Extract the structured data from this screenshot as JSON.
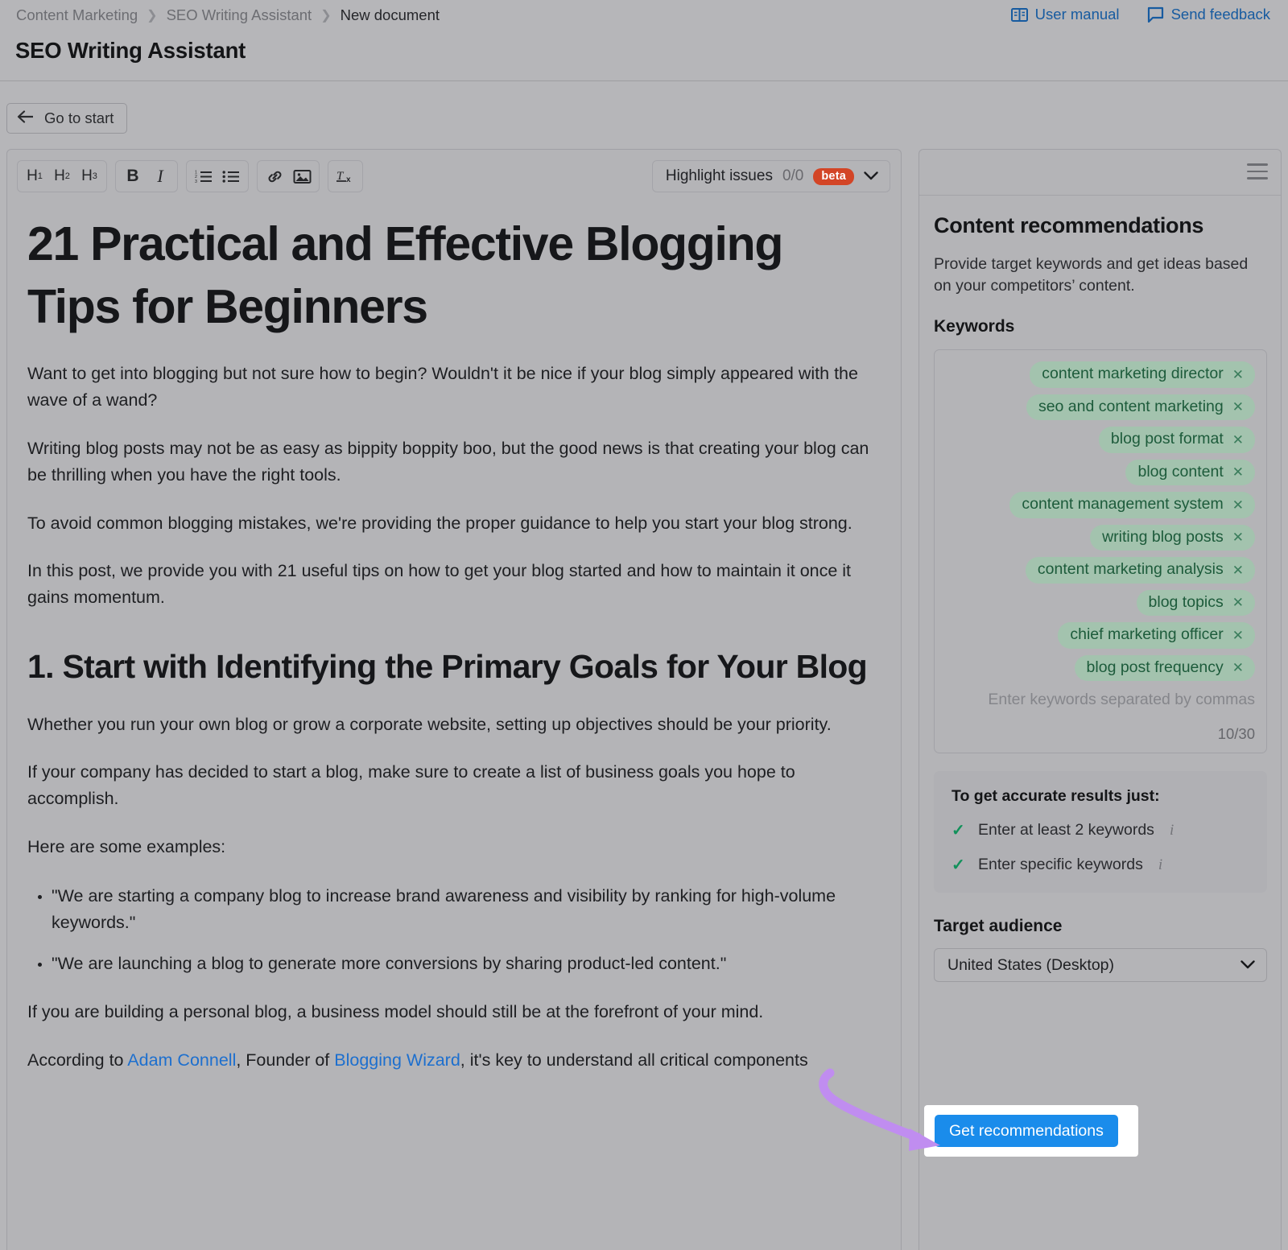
{
  "header": {
    "breadcrumb": [
      "Content Marketing",
      "SEO Writing Assistant",
      "New document"
    ],
    "title": "SEO Writing Assistant",
    "links": [
      {
        "label": "User manual",
        "icon": "book-icon"
      },
      {
        "label": "Send feedback",
        "icon": "speech-bubble-icon"
      }
    ]
  },
  "subbar": {
    "go_to_start": "Go to start"
  },
  "toolbar": {
    "headings": [
      "H1",
      "H2",
      "H3"
    ],
    "bold": "B",
    "italic": "I",
    "ordered_list": "ordered-list-icon",
    "bullet_list": "bullet-list-icon",
    "link": "link-icon",
    "image": "image-icon",
    "clear_format": "Tx",
    "highlight_issues": {
      "label": "Highlight issues",
      "count": "0/0",
      "badge": "beta"
    }
  },
  "document": {
    "h1": "21 Practical and Effective Blogging Tips for Beginners",
    "p1": "Want to get into blogging but not sure how to begin? Wouldn't it be nice if your blog simply appeared with the wave of a wand?",
    "p2": "Writing blog posts may not be as easy as bippity boppity boo, but the good news is that creating your blog can be thrilling when you have the right tools.",
    "p3": "To avoid common blogging mistakes, we're providing the proper guidance to help you start your blog strong.",
    "p4": "In this post, we provide you with 21 useful tips on how to get your blog started and how to maintain it once it gains momentum.",
    "h2": "1. Start with Identifying the Primary Goals for Your Blog",
    "p5": "Whether you run your own blog or grow a corporate website, setting up objectives should be your priority.",
    "p6": "If your company has decided to start a blog, make sure to create a list of business goals you hope to accomplish.",
    "p7": "Here are some examples:",
    "bullets": [
      "\"We are starting a company blog to increase brand awareness and visibility by ranking for high-volume keywords.\"",
      "\"We are launching a blog to generate more conversions by sharing product-led content.\""
    ],
    "p8": "If you are building a personal blog, a business model should still be at the forefront of your mind.",
    "p9_a": "According to ",
    "p9_link1": "Adam Connell",
    "p9_b": ", Founder of ",
    "p9_link2": "Blogging Wizard",
    "p9_c": ", it's key to understand all critical components"
  },
  "side_panel": {
    "menu_icon": "hamburger-icon",
    "title": "Content recommendations",
    "description": "Provide target keywords and get ideas based on your competitors’ content.",
    "keywords_label": "Keywords",
    "keywords": [
      "content marketing director",
      "seo and content marketing",
      "blog post format",
      "blog content",
      "content management system",
      "writing blog posts",
      "content marketing analysis",
      "blog topics",
      "chief marketing officer",
      "blog post frequency"
    ],
    "keywords_placeholder": "Enter keywords separated by commas",
    "keywords_counter": "10/30",
    "accurate_title": "To get accurate results just:",
    "accurate_items": [
      "Enter at least 2 keywords",
      "Enter specific keywords"
    ],
    "target_audience_label": "Target audience",
    "target_audience_value": "United States (Desktop)",
    "cta_label": "Get recommendations"
  },
  "colors": {
    "page_bg": "#b6b6b9",
    "link_blue": "#175ba0",
    "cta_blue": "#1a8ceb",
    "chip_bg": "#a3c3ae",
    "chip_text": "#1d5b3b",
    "beta_badge": "#d34526",
    "check_green": "#12915b",
    "annotation_arrow": "#c08df0"
  }
}
